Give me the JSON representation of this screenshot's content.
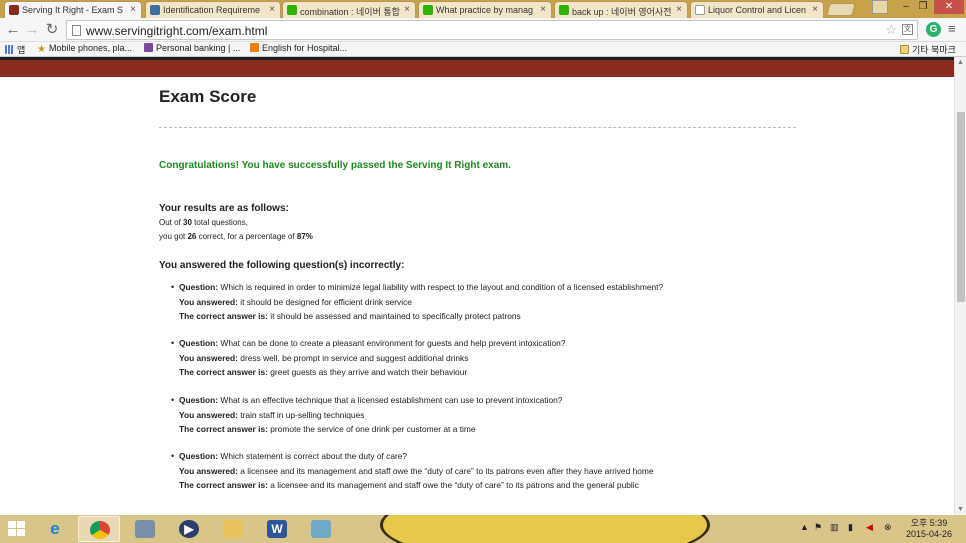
{
  "browser": {
    "tabs": [
      {
        "title": "Serving It Right - Exam S",
        "active": true,
        "favicon_color": "#8a2c1d"
      },
      {
        "title": "Identification Requireme",
        "active": false,
        "favicon_color": "#3a6ea5"
      },
      {
        "title": "combination : 네이버 통합",
        "active": false,
        "favicon_color": "#2db400"
      },
      {
        "title": "What practice by manag",
        "active": false,
        "favicon_color": "#2db400"
      },
      {
        "title": "back up : 네이버 영어사전",
        "active": false,
        "favicon_color": "#2db400"
      },
      {
        "title": "Liquor Control and Licen",
        "active": false,
        "favicon_color": "#dddddd"
      }
    ],
    "url": "www.servingitright.com/exam.html",
    "window_buttons": {
      "minimize": "–",
      "maximize": "❐",
      "close": "✕"
    },
    "bookmarks": [
      {
        "label": "앱",
        "icon": "apps-grid-icon"
      },
      {
        "label": "Mobile phones, pla...",
        "icon": "star-icon"
      },
      {
        "label": "Personal banking | ...",
        "icon": "bank-icon"
      },
      {
        "label": "English for Hospital...",
        "icon": "blogger-icon"
      }
    ],
    "other_bookmarks": "기타 북마크"
  },
  "page": {
    "heading": "Exam Score",
    "congrats": "Congratulations! You have successfully passed the Serving It Right exam.",
    "results_title": "Your results are as follows:",
    "results_line1_prefix": "Out of ",
    "total_questions": "30",
    "results_line1_suffix": " total questions,",
    "results_line2_prefix": "you got ",
    "correct_count": "26",
    "results_line2_mid": " correct, for a percentage of ",
    "percentage": "87%",
    "incorrect_title": "You answered the following question(s) incorrectly:",
    "labels": {
      "question": "Question:",
      "answered": "You answered:",
      "correct": "The correct answer is:"
    },
    "questions": [
      {
        "question": "Which is required in order to minimize legal liability with respect to the layout and condition of a licensed establishment?",
        "answered": "it should be designed for efficient drink service",
        "correct": "it should be assessed and maintained to specifically protect patrons"
      },
      {
        "question": "What can be done to create a pleasant environment for guests and help prevent intoxication?",
        "answered": "dress well, be prompt in service and suggest additional drinks",
        "correct": "greet guests as they arrive and watch their behaviour"
      },
      {
        "question": "What is an effective technique that a licensed establishment can use to prevent intoxication?",
        "answered": "train staff in up-selling techniques",
        "correct": "promote the service of one drink per customer at a time"
      },
      {
        "question": "Which statement is correct about the duty of care?",
        "answered": "a licensee and its management and staff owe the “duty of care” to its patrons even after they have arrived home",
        "correct": "a licensee and its management and staff owe the “duty of care” to its patrons and the general public"
      }
    ]
  },
  "taskbar": {
    "apps": [
      "internet-explorer-icon",
      "chrome-icon",
      "calculator-icon",
      "media-player-icon",
      "file-explorer-icon",
      "word-icon",
      "paint-icon"
    ],
    "clock_period": "오후",
    "clock_time": "5:39",
    "clock_date": "2015-04-26"
  }
}
